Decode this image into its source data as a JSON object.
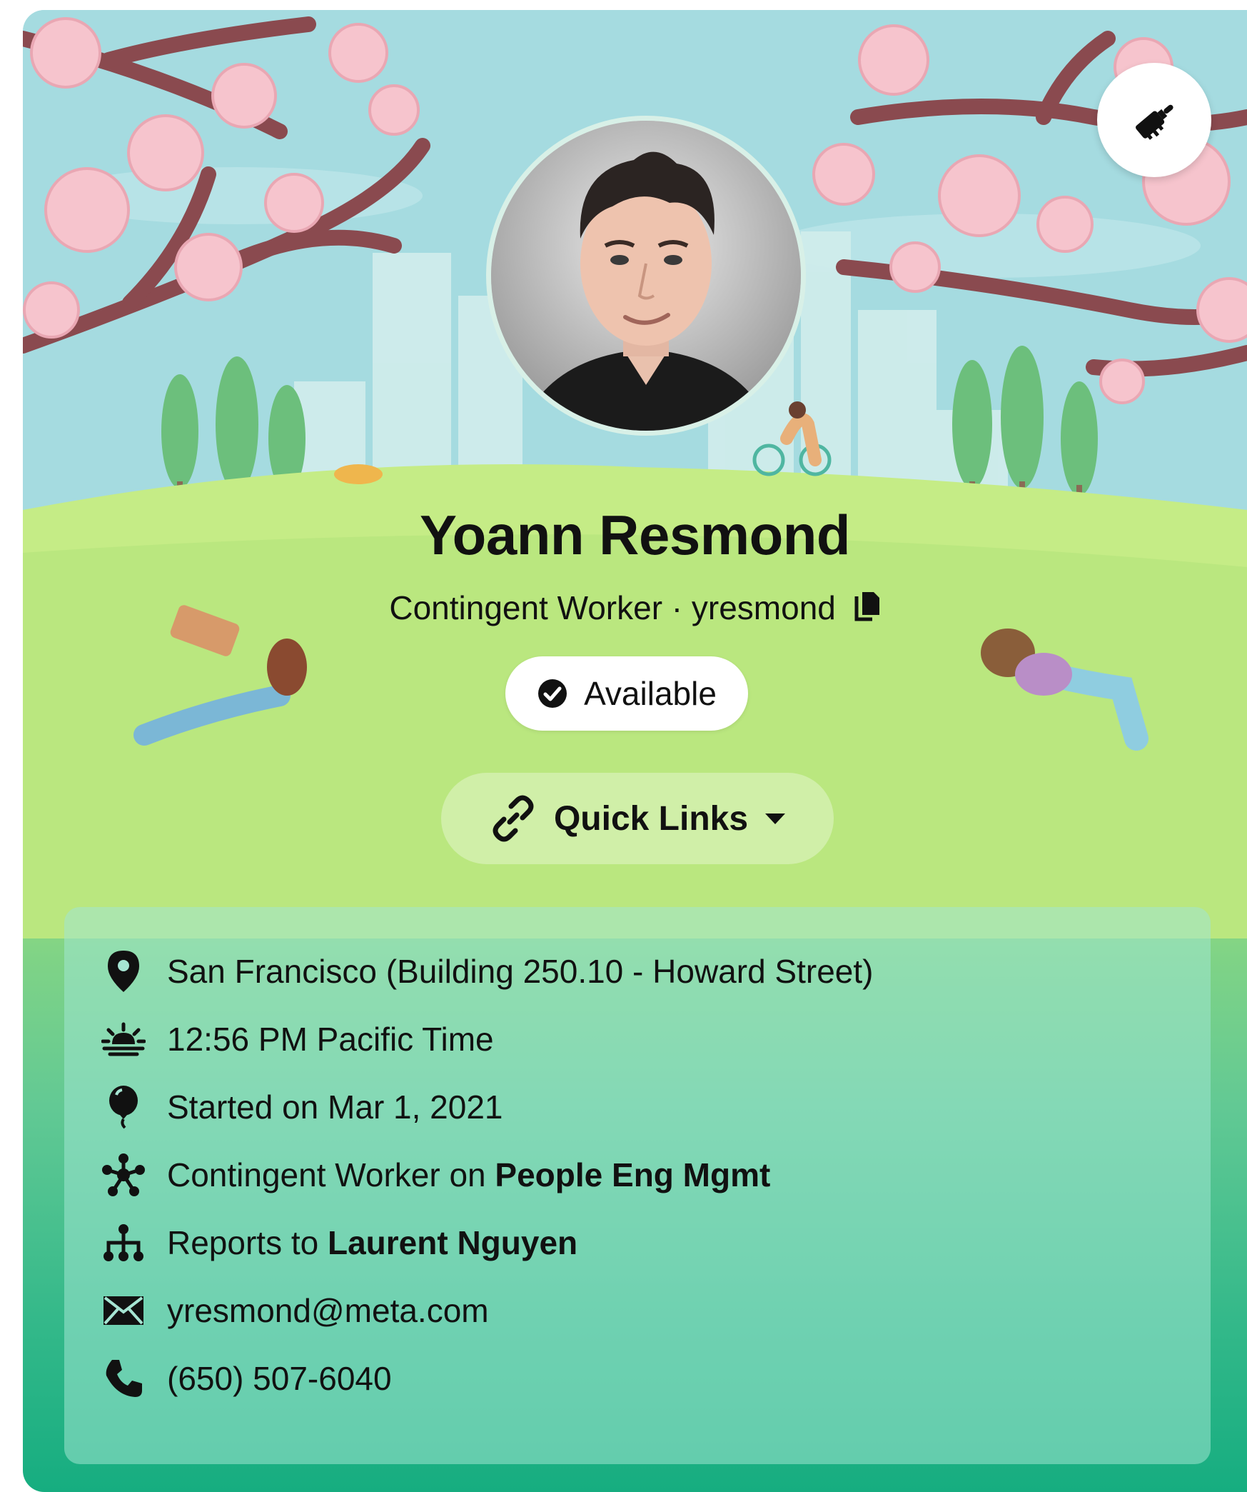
{
  "profile": {
    "name": "Yoann Resmond",
    "role": "Contingent Worker",
    "separator": "·",
    "username": "yresmond",
    "status": "Available",
    "quick_links_label": "Quick Links"
  },
  "details": {
    "location": "San Francisco (Building 250.10 - Howard Street)",
    "local_time": "12:56 PM Pacific Time",
    "start_date": "Started on Mar 1, 2021",
    "team_prefix": "Contingent Worker on ",
    "team": "People Eng Mgmt",
    "manager_prefix": "Reports to ",
    "manager": "Laurent Nguyen",
    "email": "yresmond@meta.com",
    "phone": "(650) 507-6040"
  },
  "icons": {
    "cover": "paintbrush-icon",
    "copy": "copy-icon",
    "status": "check-circle-icon",
    "links": "link-icon",
    "dropdown": "caret-down-icon",
    "location": "map-pin-icon",
    "time": "sunrise-icon",
    "start": "balloon-icon",
    "team": "team-network-icon",
    "manager": "org-chart-icon",
    "email": "envelope-icon",
    "phone": "phone-icon"
  },
  "colors": {
    "sky": "#9dd8dc",
    "grass": "#b9e77e",
    "card_bottom": "#16ad80",
    "blossom": "#f6c7cf",
    "branch": "#8a4a4f"
  }
}
